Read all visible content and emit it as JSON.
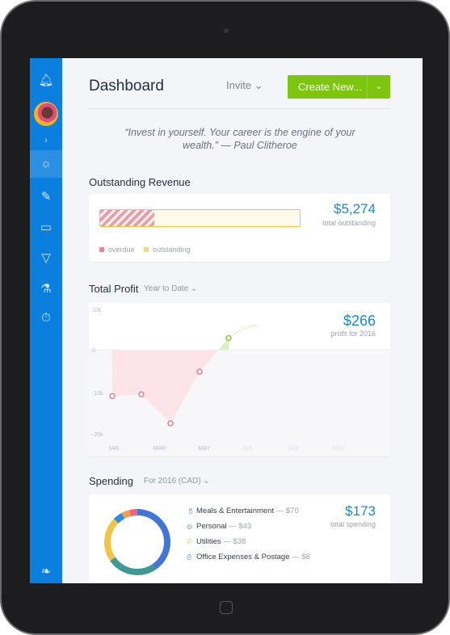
{
  "header": {
    "title": "Dashboard",
    "invite_label": "Invite",
    "create_label": "Create New..."
  },
  "quote": "“Invest in yourself. Your career is the engine of your wealth.” — Paul Clitheroe",
  "sidebar": {
    "icons": [
      "bell-icon",
      "avatar",
      "expand-chevron-icon",
      "dashboard-sunrise-icon",
      "invoices-icon",
      "expenses-icon",
      "pizza-icon",
      "flask-icon",
      "timer-icon",
      "leaf-logo-icon"
    ],
    "color": "#0a7fdd"
  },
  "revenue": {
    "title": "Outstanding Revenue",
    "total": "$5,274",
    "total_label": "total outstanding",
    "overdue_fraction": 0.27,
    "legend": [
      "overdue",
      "outstanding"
    ],
    "colors": {
      "overdue": "#f4828f",
      "outstanding": "#f0c447"
    }
  },
  "profit": {
    "title": "Total Profit",
    "range": "Year to Date",
    "total": "$266",
    "total_label": "profit for 2016"
  },
  "spending": {
    "title": "Spending",
    "range": "For 2016 (CAD)",
    "total": "$173",
    "total_label": "total spending",
    "items": [
      {
        "icon": "fork-knife-icon",
        "label": "Meals & Entertainment",
        "amount": "— $70"
      },
      {
        "icon": "personal-icon",
        "label": "Personal",
        "amount": "— $43"
      },
      {
        "icon": "utilities-icon",
        "label": "Utilities",
        "amount": "— $38"
      },
      {
        "icon": "office-icon",
        "label": "Office Expenses & Postage",
        "amount": "— $8"
      }
    ]
  },
  "chart_data": [
    {
      "type": "area",
      "y_ticks": [
        "10k",
        "0",
        "-10k",
        "-20k"
      ],
      "ylim": [
        -20000,
        10000
      ],
      "x_ticks": [
        "JAN",
        "MAR",
        "MAY",
        "JUL",
        "SEP",
        "NOV"
      ],
      "points": [
        -11000,
        -10600,
        -17500,
        -5200,
        2800
      ],
      "colors": {
        "negative": "#f07b8a",
        "positive": "#8cc63f"
      }
    },
    {
      "type": "pie",
      "values": [
        70,
        43,
        38,
        8,
        7,
        7
      ],
      "colors": [
        "#4275d6",
        "#3f9893",
        "#f0c447",
        "#2a8fe0",
        "#f39c4a",
        "#f2637a"
      ]
    }
  ]
}
